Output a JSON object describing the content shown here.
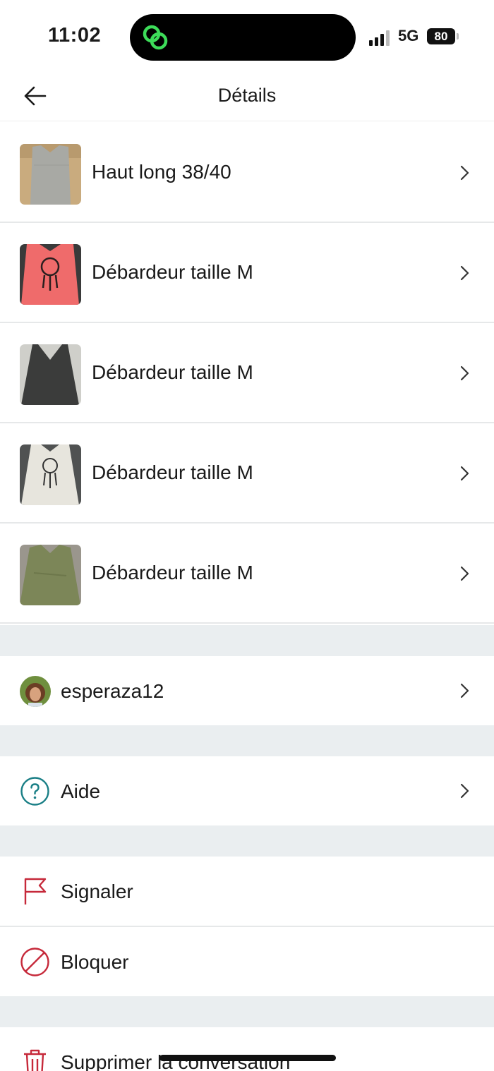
{
  "status_bar": {
    "time": "11:02",
    "network": "5G",
    "battery": "80",
    "activity_icon": "linked-rings-icon",
    "activity_color": "#3ddc59"
  },
  "header": {
    "title": "Détails",
    "back_icon": "arrow-left-icon"
  },
  "items": [
    {
      "title": "Haut long 38/40",
      "thumb": "grey-long-top-photo"
    },
    {
      "title": "Débardeur taille M",
      "thumb": "coral-dreamcatcher-tank-photo"
    },
    {
      "title": "Débardeur taille M",
      "thumb": "dark-grey-tank-photo"
    },
    {
      "title": "Débardeur taille M",
      "thumb": "white-dreamcatcher-tank-photo"
    },
    {
      "title": "Débardeur taille M",
      "thumb": "khaki-tank-photo"
    }
  ],
  "user": {
    "username": "esperaza12"
  },
  "menu": {
    "help": "Aide",
    "report": "Signaler",
    "block": "Bloquer",
    "delete": "Supprimer la conversation"
  },
  "colors": {
    "help_accent": "#1a7f86",
    "danger": "#c6293a",
    "section_gap": "#eaeef0"
  }
}
